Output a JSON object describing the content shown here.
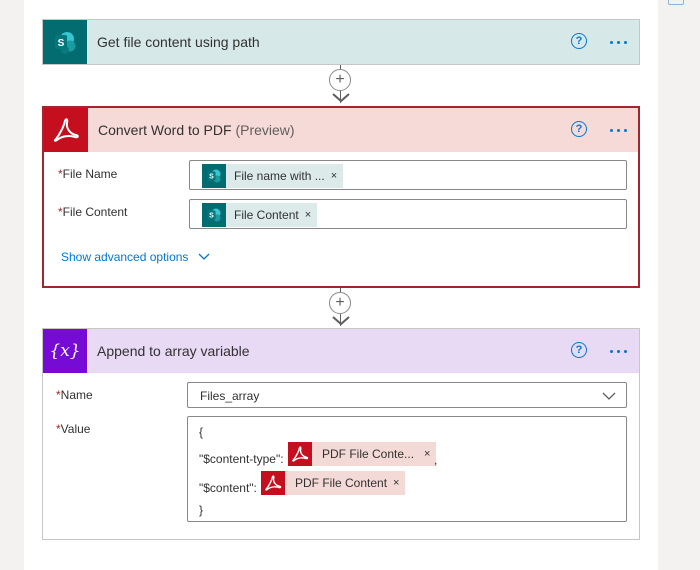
{
  "cards": {
    "get_file": {
      "title": "Get file content using path",
      "help_glyph": "?",
      "head_bg": "#d7e8e8",
      "icon": "sharepoint-icon"
    },
    "convert": {
      "title": "Convert Word to PDF",
      "title_suffix": "(Preview)",
      "help_glyph": "?",
      "head_bg": "#f5dad7",
      "border": "#a4262c",
      "icon": "acrobat-icon",
      "fields": [
        {
          "required": "*",
          "label": "File Name",
          "token": {
            "text": "File name with ...",
            "icon": "sharepoint-icon"
          }
        },
        {
          "required": "*",
          "label": "File Content",
          "token": {
            "text": "File Content",
            "icon": "sharepoint-icon"
          }
        }
      ],
      "advanced_label": "Show advanced options"
    },
    "append": {
      "title": "Append to array variable",
      "help_glyph": "?",
      "head_bg": "#e8d9f4",
      "icon": "variable-icon",
      "icon_glyph": "{x}",
      "name_field": {
        "required": "*",
        "label": "Name",
        "value": "Files_array"
      },
      "value_field": {
        "required": "*",
        "label": "Value",
        "lines": {
          "open": "{",
          "content_type_key": "\"$content-type\":",
          "content_type_token": "PDF File Conte...",
          "comma": ",",
          "content_key": "\"$content\":",
          "content_token": "PDF File Content",
          "close": "}"
        }
      }
    }
  },
  "connector_glyph": "+",
  "token_remove_glyph": "×"
}
